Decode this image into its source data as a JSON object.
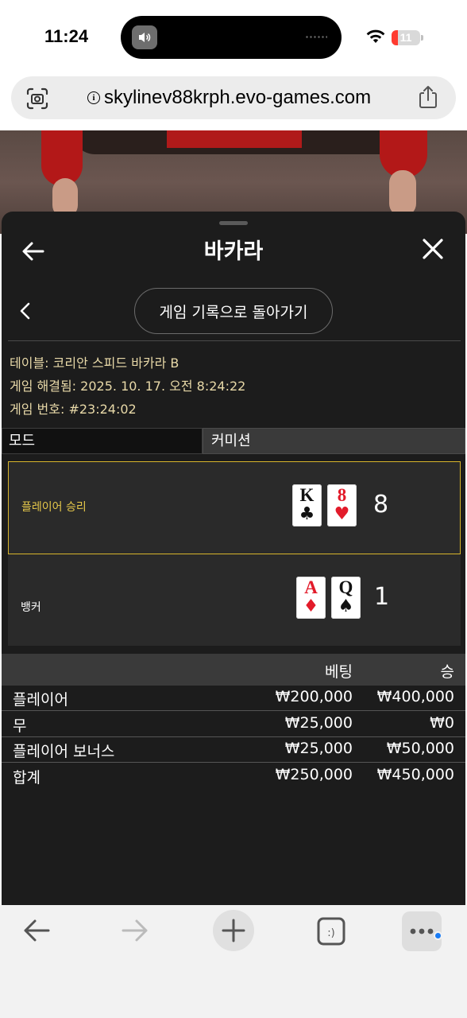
{
  "status_bar": {
    "time": "11:24",
    "battery": "11",
    "icons": [
      "speaker-icon",
      "wifi-icon",
      "battery-icon"
    ]
  },
  "browser": {
    "url": "skylinev88krph.evo-games.com",
    "icons": [
      "lens-icon",
      "info-icon",
      "share-icon"
    ]
  },
  "sheet": {
    "title": "바카라",
    "history_button": "게임 기록으로 돌아가기",
    "info": {
      "table_label": "테이블:",
      "table_value": "코리안 스피드 바카라 B",
      "resolved_label": "게임 해결됨:",
      "resolved_value": "2025. 10. 17. 오전 8:24:22",
      "number_label": "게임 번호:",
      "number_value": "#23:24:02"
    },
    "mode": {
      "label": "모드",
      "value": "커미션"
    },
    "results": {
      "player": {
        "label": "플레이어 승리",
        "cards": [
          {
            "rank": "K",
            "suit": "♣",
            "color": "#111111"
          },
          {
            "rank": "8",
            "suit": "♥",
            "color": "#e21b2a"
          }
        ],
        "score": "8"
      },
      "banker": {
        "label": "뱅커",
        "cards": [
          {
            "rank": "A",
            "suit": "♦",
            "color": "#e21b2a"
          },
          {
            "rank": "Q",
            "suit": "♠",
            "color": "#111111"
          }
        ],
        "score": "1"
      }
    },
    "bets": {
      "header": {
        "bet": "베팅",
        "win": "승"
      },
      "rows": [
        {
          "name": "플레이어",
          "bet": "₩200,000",
          "win": "₩400,000"
        },
        {
          "name": "무",
          "bet": "₩25,000",
          "win": "₩0"
        },
        {
          "name": "플레이어 보너스",
          "bet": "₩25,000",
          "win": "₩50,000"
        }
      ],
      "total": {
        "name": "합계",
        "bet": "₩250,000",
        "win": "₩450,000"
      }
    }
  },
  "toolbar": {
    "tab_button_label": ":)",
    "icons": [
      "back-arrow-icon",
      "forward-arrow-icon",
      "plus-icon",
      "tabs-icon",
      "more-icon"
    ]
  },
  "colors": {
    "winner_border": "#d8b52b",
    "info_text": "#e8d9a8",
    "sheet_bg": "#1c1c1c",
    "badge_blue": "#1a7cf5"
  }
}
